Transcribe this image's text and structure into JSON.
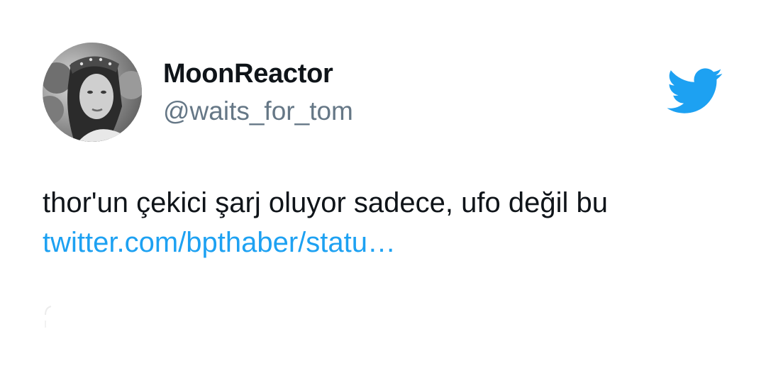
{
  "author": {
    "display_name": "MoonReactor",
    "handle": "@waits_for_tom",
    "avatar_icon": "user-avatar-photo"
  },
  "brand": {
    "logo_icon": "twitter-bird-icon",
    "logo_color": "#1da1f2"
  },
  "tweet": {
    "text": "thor'un çekici şarj oluyor sadece, ufo değil bu",
    "link_text": "twitter.com/bpthaber/statu…",
    "link_color": "#1da1f2"
  },
  "colors": {
    "text_primary": "#0f1419",
    "text_secondary": "#657786",
    "background": "#ffffff"
  }
}
